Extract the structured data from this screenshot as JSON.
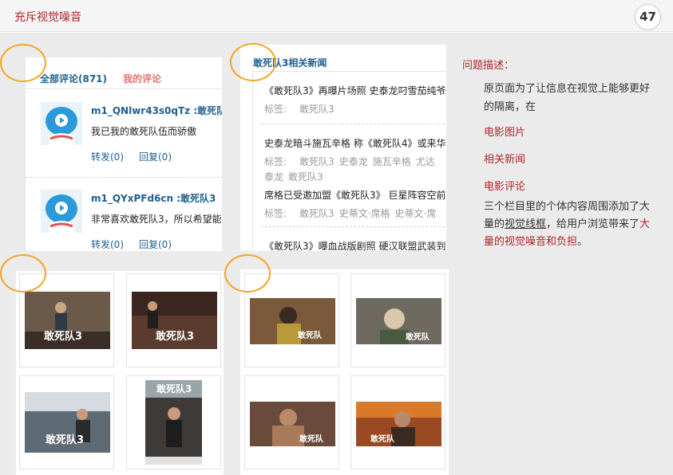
{
  "header": {
    "title": "充斥视觉噪音",
    "page_number": "47"
  },
  "comments": {
    "tab_all": "全部评论(871)",
    "tab_mine": "我的评论",
    "items": [
      {
        "user": "m1_QNlwr43s0qTz :敢死队3",
        "text": "我已我的敢死队伍而骄傲",
        "forward": "转发(0)",
        "reply": "回复(0)"
      },
      {
        "user": "m1_QYxPFd6cn :敢死队3",
        "text": "非常喜欢敢死队3，所以希望能行",
        "forward": "转发(0)",
        "reply": "回复(0)"
      }
    ]
  },
  "news": {
    "title": "敢死队3相关新闻",
    "tag_label": "标签:",
    "items": [
      {
        "headline": "《敢死队3》再曝片场照 史泰龙叼雪茄纯爷",
        "tags": [
          "敢死队3"
        ]
      },
      {
        "headline": "史泰龙暗斗施瓦辛格 称《敢死队4》或来华",
        "tags": [
          "敢死队3",
          "史泰龙",
          "施瓦辛格",
          "尤达"
        ],
        "tags2": [
          "泰龙",
          "敢死队3"
        ]
      },
      {
        "headline": "席格已受邀加盟《敢死队3》 巨星阵容空前",
        "tags": [
          "敢死队3",
          "史蒂文·席格",
          "史蒂文·席"
        ]
      },
      {
        "headline": "《敢死队3》曝血战版剧照 硬汉联盟武装到",
        "tags": []
      }
    ]
  },
  "gallery_left": {
    "thumbs": [
      {
        "caption": "敢死队3",
        "tone": "#6b5a4a"
      },
      {
        "caption": "敢死队3",
        "tone": "#5a3b2e"
      },
      {
        "caption": "敢死队3",
        "tone": "#5f6b74"
      },
      {
        "caption": "敢死队3",
        "tone": "#3d3a38"
      }
    ]
  },
  "gallery_right": {
    "thumbs": [
      {
        "caption": "敢死队",
        "tone": "#7a5a3a"
      },
      {
        "caption": "敢死队",
        "tone": "#6e6a60"
      },
      {
        "caption": "敢死队",
        "tone": "#6a4a3a"
      },
      {
        "caption": "敢死队",
        "tone": "#9a4a22"
      }
    ]
  },
  "description": {
    "label": "问题描述：",
    "line1": "原页面为了让信息在视觉上能够更好",
    "line2": "的隔离，在",
    "item1": "电影图片",
    "item2": "相关新闻",
    "item3": "电影评论",
    "line3": "三个栏目里的个体内容周围添加了大",
    "line4_a": "量的",
    "line4_u": "视觉线框",
    "line4_b": "，给用户浏览带来了",
    "line4_r": "大",
    "line5_r": "量的视觉噪音和负担",
    "line5_end": "。"
  },
  "colors": {
    "brand_red": "#b3252b",
    "link_blue": "#1f5f8e",
    "marker_orange": "#f2a623"
  }
}
